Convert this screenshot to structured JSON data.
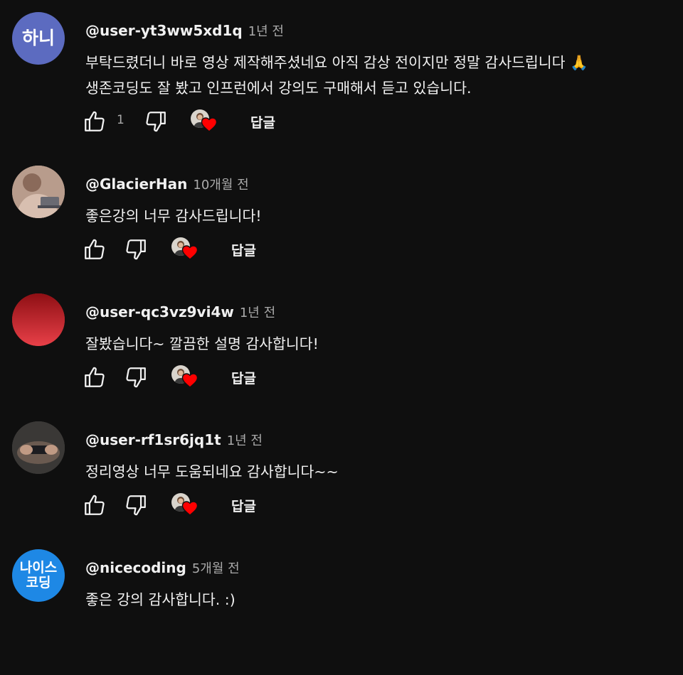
{
  "comments": [
    {
      "avatar_text": "하니",
      "avatar_color": "#5c6bc0",
      "author": "@user-yt3ww5xd1q",
      "time": "1년 전",
      "text_line1": "부탁드렸더니 바로 영상 제작해주셨네요 아직 감상 전이지만 정말 감사드립니다 🙏",
      "text_line2": "생존코딩도 잘 봤고 인프런에서 강의도 구매해서 듣고 있습니다.",
      "like_count": "1",
      "reply_label": "답글"
    },
    {
      "avatar_text": "",
      "avatar_color": "#c8a898",
      "author": "@GlacierHan",
      "time": "10개월 전",
      "text_line1": "좋은강의 너무 감사드립니다!",
      "like_count": "",
      "reply_label": "답글"
    },
    {
      "avatar_text": "",
      "avatar_color": "#c62828",
      "author": "@user-qc3vz9vi4w",
      "time": "1년 전",
      "text_line1": "잘봤습니다~ 깔끔한 설명 감사합니다!",
      "like_count": "",
      "reply_label": "답글"
    },
    {
      "avatar_text": "",
      "avatar_color": "#4a4a4a",
      "author": "@user-rf1sr6jq1t",
      "time": "1년 전",
      "text_line1": "정리영상 너무 도움되네요 감사합니다~~",
      "like_count": "",
      "reply_label": "답글"
    },
    {
      "avatar_text": "나이스\n코딩",
      "avatar_color": "#1e88e5",
      "author": "@nicecoding",
      "time": "5개월 전",
      "text_line1": "좋은 강의 감사합니다. :)"
    }
  ],
  "colors": {
    "background": "#0f0f0f",
    "text": "#f1f1f1",
    "secondary_text": "#aaaaaa",
    "heart": "#ff0000"
  },
  "icons": {
    "like": "thumb-up-icon",
    "dislike": "thumb-down-icon",
    "creator_heart": "creator-heart-icon"
  }
}
